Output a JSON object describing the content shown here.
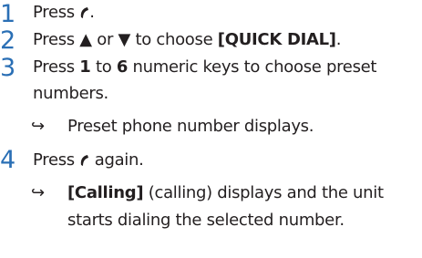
{
  "steps": [
    {
      "number": "1",
      "press": "Press",
      "tail": "."
    },
    {
      "number": "2",
      "press": "Press",
      "up": "▲",
      "or": "or",
      "down": "▼",
      "to_choose": "to choose",
      "menu": "[QUICK DIAL]",
      "tail": "."
    },
    {
      "number": "3",
      "press": "Press",
      "key_from": "1",
      "to": "to",
      "key_to": "6",
      "rest": "numeric keys to choose preset",
      "rest2": "numbers.",
      "result": "Preset phone number displays."
    },
    {
      "number": "4",
      "press": "Press",
      "tail": "again.",
      "result_label": "[Calling]",
      "result_rest": "(calling) displays and the unit",
      "result_rest2": "starts dialing the selected number."
    }
  ],
  "result_arrow": "↪"
}
